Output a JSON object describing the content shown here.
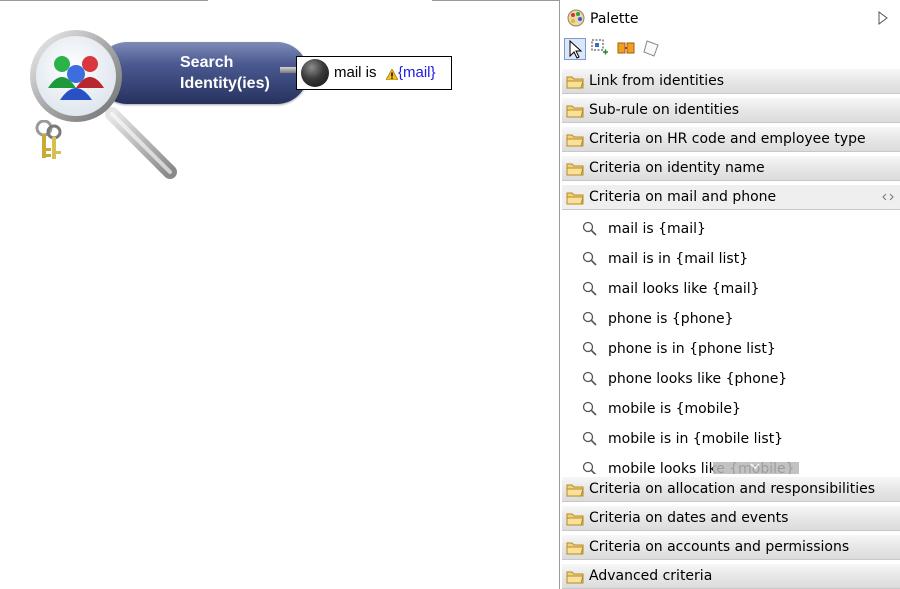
{
  "canvas": {
    "search_node": {
      "label_line1": "Search",
      "label_line2": "Identity(ies)"
    },
    "criteria": {
      "text": "mail is",
      "variable": "{mail}"
    }
  },
  "palette": {
    "title": "Palette",
    "tools": [
      "select-tool-icon",
      "marquee-tool-icon",
      "connection-tool-icon",
      "note-tool-icon"
    ],
    "drawers_before": [
      {
        "label": "Link from identities"
      },
      {
        "label": "Sub-rule on identities"
      },
      {
        "label": "Criteria on HR code and employee type"
      },
      {
        "label": "Criteria on identity name"
      }
    ],
    "open_drawer": {
      "label": "Criteria on mail and phone",
      "items": [
        {
          "label": "mail is {mail}"
        },
        {
          "label": "mail is in {mail list}"
        },
        {
          "label": "mail looks like {mail}"
        },
        {
          "label": "phone is {phone}"
        },
        {
          "label": "phone is in {phone list}"
        },
        {
          "label": "phone looks like {phone}"
        },
        {
          "label": "mobile is {mobile}"
        },
        {
          "label": "mobile is in {mobile list}"
        },
        {
          "label": "mobile looks like {mobile}"
        }
      ]
    },
    "drawers_after": [
      {
        "label": "Criteria on allocation and responsibilities"
      },
      {
        "label": "Criteria on dates and events"
      },
      {
        "label": "Criteria on accounts and permissions"
      },
      {
        "label": "Advanced criteria"
      }
    ]
  },
  "colors": {
    "pill": "#3a4678",
    "variable": "#1a1ae6",
    "drawer": "#e7e7e7"
  }
}
